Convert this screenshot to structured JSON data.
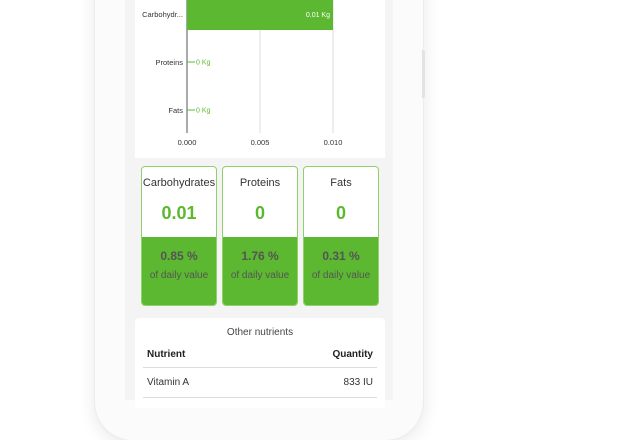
{
  "colors": {
    "accent": "#5bb830",
    "accent_text": "#5cb831",
    "border": "#8fd06a"
  },
  "chart_data": {
    "type": "bar",
    "orientation": "horizontal",
    "categories": [
      "Carbohydr...",
      "Proteins",
      "Fats"
    ],
    "values": [
      0.01,
      0,
      0
    ],
    "value_labels": [
      "0.01 Kg",
      "0 Kg",
      "0 Kg"
    ],
    "xticks": [
      "0.000",
      "0.005",
      "0.010"
    ],
    "xlim": [
      0,
      0.01
    ],
    "grid": true
  },
  "macros": [
    {
      "name": "Carbohydrates",
      "value": "0.01",
      "percent": "0.85 %",
      "sub": "of daily value"
    },
    {
      "name": "Proteins",
      "value": "0",
      "percent": "1.76 %",
      "sub": "of daily value"
    },
    {
      "name": "Fats",
      "value": "0",
      "percent": "0.31 %",
      "sub": "of daily value"
    }
  ],
  "other_nutrients": {
    "title": "Other nutrients",
    "headers": {
      "nutrient": "Nutrient",
      "quantity": "Quantity"
    },
    "rows": [
      {
        "nutrient": "Vitamin A",
        "quantity": "833 IU"
      }
    ]
  }
}
